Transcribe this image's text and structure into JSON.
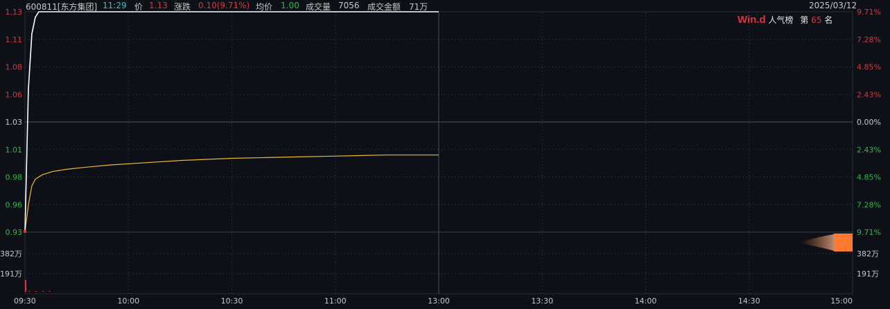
{
  "header": {
    "code_name": "600811[东方集团]",
    "time": "11:29",
    "price_label": "价",
    "price": "1.13",
    "change_label": "涨跌",
    "change": "0.10(9.71%)",
    "avg_label": "均价",
    "avg": "1.00",
    "volume_label": "成交量",
    "volume": "7056",
    "amount_label": "成交金额",
    "amount": "71万",
    "date": "2025/03/12"
  },
  "popularity": {
    "logo": "Win.d",
    "label": "人气榜",
    "rank_prefix": "第",
    "rank": "65",
    "rank_suffix": "名"
  },
  "colors": {
    "up": "#e0323a",
    "down": "#2db84d",
    "neutral": "#c8c8c8",
    "price_line": "#ffffff",
    "avg_line": "#f0b92a",
    "grid": "#2a2f36",
    "volume_bar": "#ff7a30"
  },
  "chart_data": {
    "type": "line",
    "x_ticks": [
      "09:30",
      "10:00",
      "10:30",
      "11:00",
      "13:00",
      "13:30",
      "14:00",
      "14:30",
      "15:00"
    ],
    "price_ticks": [
      {
        "label": "1.13",
        "value": 1.13,
        "pct": "9.71%",
        "dir": "up"
      },
      {
        "label": "1.11",
        "value": 1.105,
        "pct": "7.28%",
        "dir": "up"
      },
      {
        "label": "1.08",
        "value": 1.08,
        "pct": "4.85%",
        "dir": "up"
      },
      {
        "label": "1.06",
        "value": 1.055,
        "pct": "2.43%",
        "dir": "up"
      },
      {
        "label": "1.03",
        "value": 1.03,
        "pct": "0.00%",
        "dir": "flat"
      },
      {
        "label": "1.01",
        "value": 1.005,
        "pct": "2.43%",
        "dir": "down"
      },
      {
        "label": "0.98",
        "value": 0.98,
        "pct": "4.85%",
        "dir": "down"
      },
      {
        "label": "0.96",
        "value": 0.955,
        "pct": "7.28%",
        "dir": "down"
      },
      {
        "label": "0.93",
        "value": 0.93,
        "pct": "9.71%",
        "dir": "down"
      }
    ],
    "ylim": [
      0.93,
      1.13
    ],
    "volume_ticks": [
      "382万",
      "191万"
    ],
    "price_series": [
      {
        "m": 0,
        "v": 0.93
      },
      {
        "m": 1,
        "v": 1.06
      },
      {
        "m": 2,
        "v": 1.11
      },
      {
        "m": 3,
        "v": 1.125
      },
      {
        "m": 4,
        "v": 1.13
      },
      {
        "m": 120,
        "v": 1.13
      }
    ],
    "avg_series": [
      {
        "m": 0,
        "v": 0.93
      },
      {
        "m": 1,
        "v": 0.955
      },
      {
        "m": 2,
        "v": 0.972
      },
      {
        "m": 3,
        "v": 0.978
      },
      {
        "m": 5,
        "v": 0.982
      },
      {
        "m": 8,
        "v": 0.985
      },
      {
        "m": 12,
        "v": 0.987
      },
      {
        "m": 18,
        "v": 0.989
      },
      {
        "m": 25,
        "v": 0.991
      },
      {
        "m": 35,
        "v": 0.993
      },
      {
        "m": 45,
        "v": 0.995
      },
      {
        "m": 60,
        "v": 0.997
      },
      {
        "m": 75,
        "v": 0.998
      },
      {
        "m": 90,
        "v": 0.999
      },
      {
        "m": 105,
        "v": 1.0
      },
      {
        "m": 120,
        "v": 1.0
      }
    ],
    "volume_bars": [
      {
        "m": 0,
        "v": 120,
        "dir": "up"
      },
      {
        "m": 1,
        "v": 3,
        "dir": "up"
      },
      {
        "m": 3,
        "v": 1,
        "dir": "up"
      },
      {
        "m": 5,
        "v": 1,
        "dir": "up"
      },
      {
        "m": 7,
        "v": 1,
        "dir": "up"
      }
    ],
    "volume_max": 573
  }
}
